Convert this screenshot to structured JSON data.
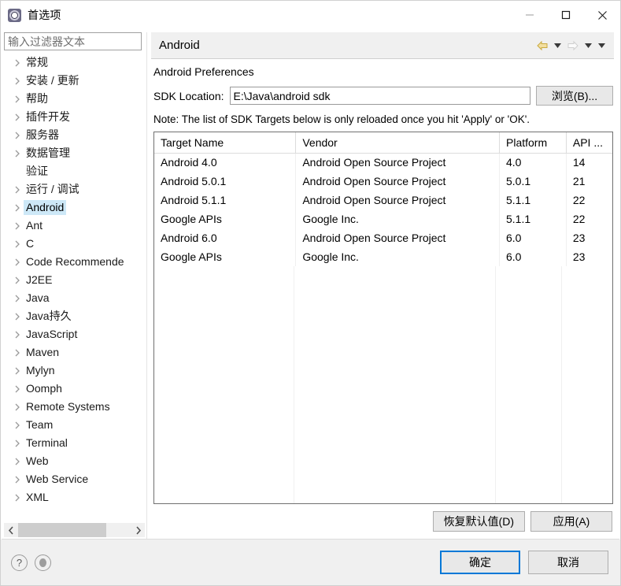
{
  "window": {
    "title": "首选项",
    "icon": "preferences-gear-icon",
    "controls": {
      "minimize": "minimize-icon",
      "maximize": "maximize-icon",
      "close": "close-icon"
    }
  },
  "sidebar": {
    "filter": {
      "placeholder": "输入过滤器文本",
      "value": ""
    },
    "items": [
      {
        "label": "常规",
        "expandable": true,
        "selected": false
      },
      {
        "label": "安装 / 更新",
        "expandable": true,
        "selected": false
      },
      {
        "label": "帮助",
        "expandable": true,
        "selected": false
      },
      {
        "label": "插件开发",
        "expandable": true,
        "selected": false
      },
      {
        "label": "服务器",
        "expandable": true,
        "selected": false
      },
      {
        "label": "数据管理",
        "expandable": true,
        "selected": false
      },
      {
        "label": "验证",
        "expandable": false,
        "selected": false
      },
      {
        "label": "运行 / 调试",
        "expandable": true,
        "selected": false
      },
      {
        "label": "Android",
        "expandable": true,
        "selected": true
      },
      {
        "label": "Ant",
        "expandable": true,
        "selected": false
      },
      {
        "label": "C",
        "expandable": true,
        "selected": false
      },
      {
        "label": "Code Recommende",
        "expandable": true,
        "selected": false
      },
      {
        "label": "J2EE",
        "expandable": true,
        "selected": false
      },
      {
        "label": "Java",
        "expandable": true,
        "selected": false
      },
      {
        "label": "Java持久",
        "expandable": true,
        "selected": false
      },
      {
        "label": "JavaScript",
        "expandable": true,
        "selected": false
      },
      {
        "label": "Maven",
        "expandable": true,
        "selected": false
      },
      {
        "label": "Mylyn",
        "expandable": true,
        "selected": false
      },
      {
        "label": "Oomph",
        "expandable": true,
        "selected": false
      },
      {
        "label": "Remote Systems",
        "expandable": true,
        "selected": false
      },
      {
        "label": "Team",
        "expandable": true,
        "selected": false
      },
      {
        "label": "Terminal",
        "expandable": true,
        "selected": false
      },
      {
        "label": "Web",
        "expandable": true,
        "selected": false
      },
      {
        "label": "Web Service",
        "expandable": true,
        "selected": false
      },
      {
        "label": "XML",
        "expandable": true,
        "selected": false
      }
    ],
    "hscroll": {
      "left_arrow": "chevron-left-icon",
      "right_arrow": "chevron-right-icon"
    }
  },
  "page": {
    "title": "Android",
    "nav": {
      "back": "back-arrow-icon",
      "back_menu": "caret-down-icon",
      "forward": "forward-arrow-icon",
      "forward_menu": "caret-down-icon",
      "view_menu": "caret-down-icon"
    },
    "section_title": "Android Preferences",
    "sdk_location": {
      "label": "SDK Location:",
      "value": "E:\\Java\\android sdk",
      "browse_label": "浏览(B)..."
    },
    "note": "Note: The list of SDK Targets below is only reloaded once you hit 'Apply' or 'OK'.",
    "table": {
      "columns": [
        "Target Name",
        "Vendor",
        "Platform",
        "API ..."
      ],
      "rows": [
        [
          "Android 4.0",
          "Android Open Source Project",
          "4.0",
          "14"
        ],
        [
          "Android 5.0.1",
          "Android Open Source Project",
          "5.0.1",
          "21"
        ],
        [
          "Android 5.1.1",
          "Android Open Source Project",
          "5.1.1",
          "22"
        ],
        [
          "Google APIs",
          "Google Inc.",
          "5.1.1",
          "22"
        ],
        [
          "Android 6.0",
          "Android Open Source Project",
          "6.0",
          "23"
        ],
        [
          "Google APIs",
          "Google Inc.",
          "6.0",
          "23"
        ]
      ]
    },
    "actions": {
      "restore_defaults": "恢复默认值(D)",
      "apply": "应用(A)"
    }
  },
  "footer": {
    "help_icon": "question-mark-icon",
    "secondary_icon": "info-circle-icon",
    "ok": "确定",
    "cancel": "取消"
  },
  "colors": {
    "selection": "#cde8f7",
    "default_button_border": "#0078d7",
    "header_bg": "#f0f0f0",
    "back_arrow": "#e8c86a"
  }
}
